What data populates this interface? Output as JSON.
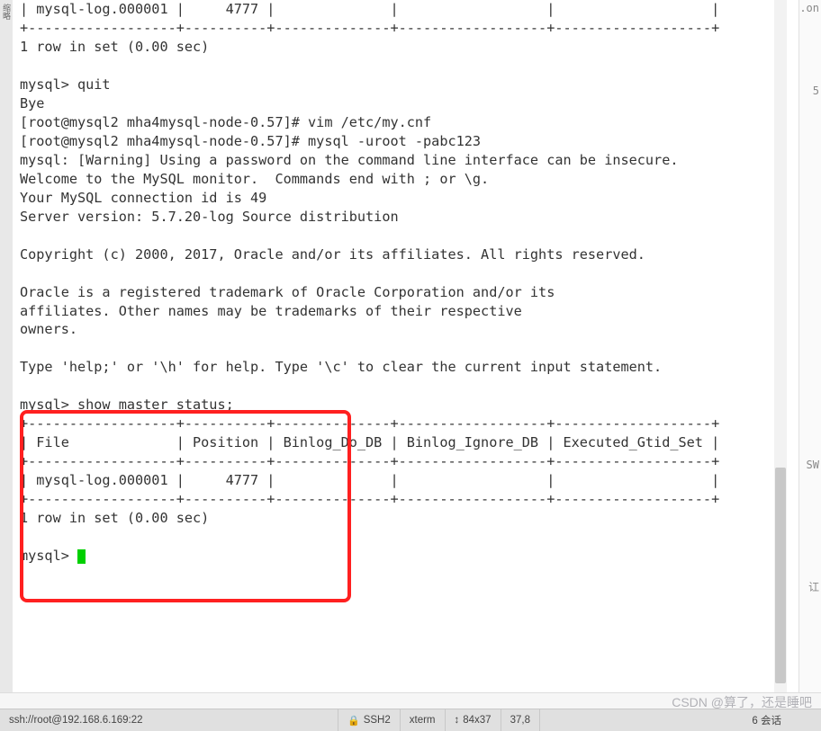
{
  "gutter_label": "缩略",
  "terminal": {
    "lines": [
      "| mysql-log.000001 |     4777 |              |                  |                   |",
      "+------------------+----------+--------------+------------------+-------------------+",
      "1 row in set (0.00 sec)",
      "",
      "mysql> quit",
      "Bye",
      "[root@mysql2 mha4mysql-node-0.57]# vim /etc/my.cnf",
      "[root@mysql2 mha4mysql-node-0.57]# mysql -uroot -pabc123",
      "mysql: [Warning] Using a password on the command line interface can be insecure.",
      "Welcome to the MySQL monitor.  Commands end with ; or \\g.",
      "Your MySQL connection id is 49",
      "Server version: 5.7.20-log Source distribution",
      "",
      "Copyright (c) 2000, 2017, Oracle and/or its affiliates. All rights reserved.",
      "",
      "Oracle is a registered trademark of Oracle Corporation and/or its",
      "affiliates. Other names may be trademarks of their respective",
      "owners.",
      "",
      "Type 'help;' or '\\h' for help. Type '\\c' to clear the current input statement.",
      "",
      "mysql> show master status;",
      "+------------------+----------+--------------+------------------+-------------------+",
      "| File             | Position | Binlog_Do_DB | Binlog_Ignore_DB | Executed_Gtid_Set |",
      "+------------------+----------+--------------+------------------+-------------------+",
      "| mysql-log.000001 |     4777 |              |                  |                   |",
      "+------------------+----------+--------------+------------------+-------------------+",
      "1 row in set (0.00 sec)",
      "",
      "mysql> "
    ]
  },
  "right_fragments": {
    "a": ".on",
    "b": "5",
    "c": "SW",
    "d": "讧"
  },
  "status": {
    "connection": "ssh://root@192.168.6.169:22",
    "proto": "SSH2",
    "term": "xterm",
    "size": "84x37",
    "pos": "37,8",
    "sessions": "6 会话"
  },
  "watermark": "CSDN @算了，还是睡吧"
}
